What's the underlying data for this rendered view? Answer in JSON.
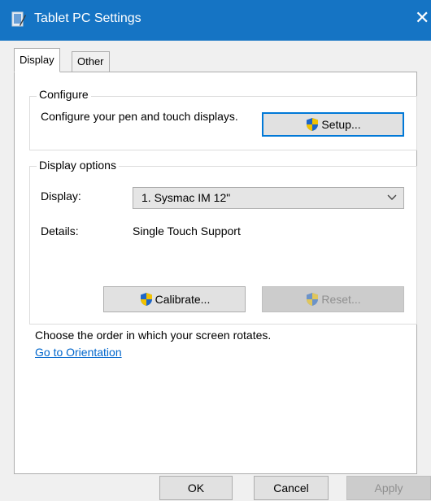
{
  "window": {
    "title": "Tablet PC Settings",
    "close_glyph": "✕"
  },
  "tabs": [
    {
      "label": "Display"
    },
    {
      "label": "Other"
    }
  ],
  "configure": {
    "title": "Configure",
    "description": "Configure your pen and touch displays.",
    "setup_label": "Setup..."
  },
  "display_options": {
    "title": "Display options",
    "display_label": "Display:",
    "display_value": "1. Sysmac IM 12\"",
    "details_label": "Details:",
    "details_value": "Single Touch Support",
    "calibrate_label": "Calibrate...",
    "reset_label": "Reset..."
  },
  "orientation": {
    "text": "Choose the order in which your screen rotates.",
    "link": "Go to Orientation"
  },
  "footer": {
    "ok": "OK",
    "cancel": "Cancel",
    "apply": "Apply"
  },
  "colors": {
    "titlebar": "#1574c4",
    "link": "#0066cc",
    "focus": "#0078d7"
  },
  "icons": [
    "tablet-icon",
    "close-icon",
    "uac-shield-icon",
    "chevron-down-icon"
  ]
}
